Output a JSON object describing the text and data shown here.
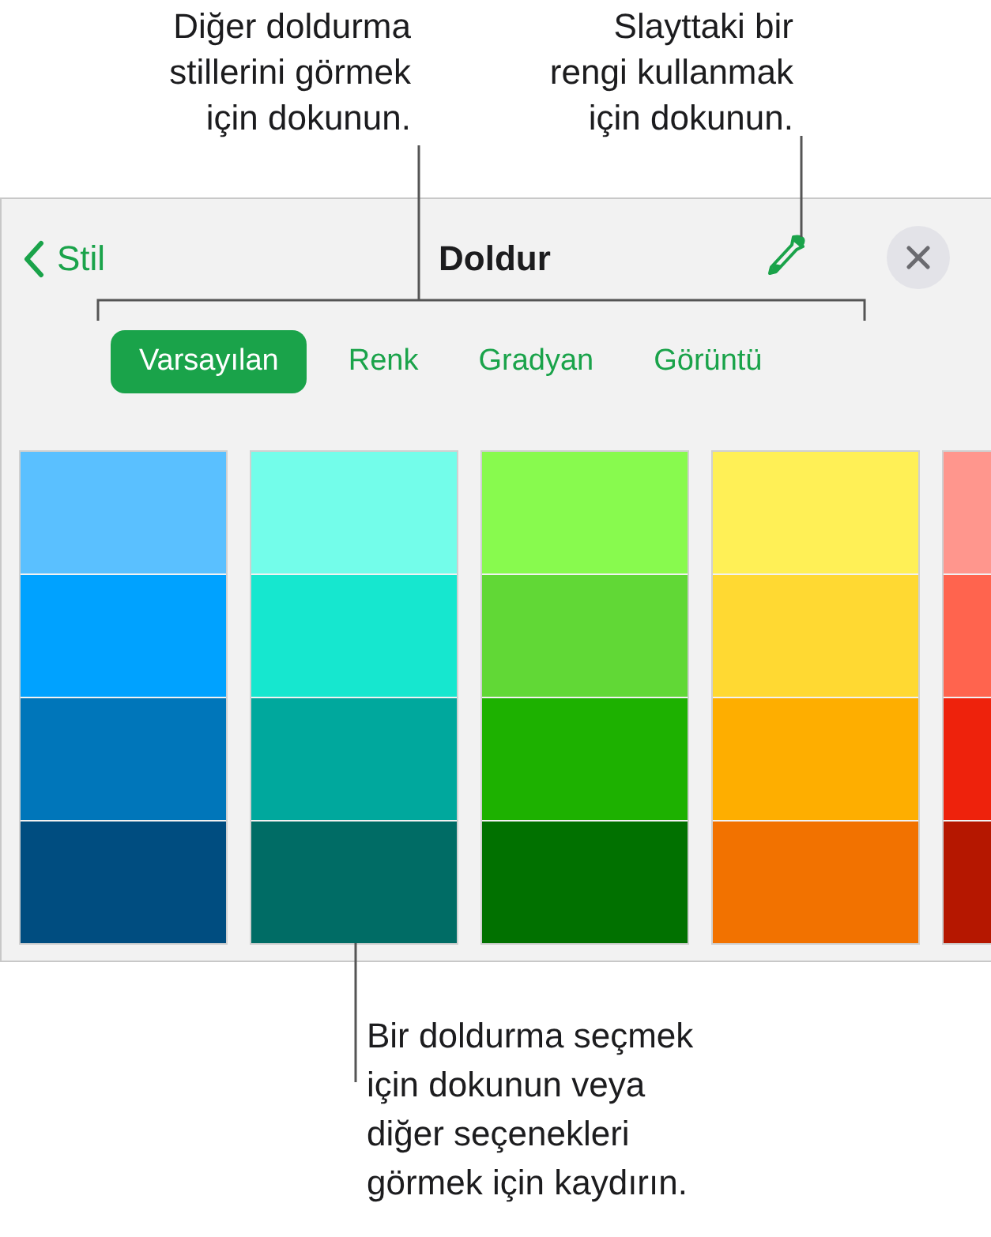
{
  "callouts": [
    {
      "text": "Diğer doldurma\nstillerini görmek\niçin dokunun."
    },
    {
      "text": "Slayttaki bir\nrengi kullanmak\niçin dokunun."
    },
    {
      "text": "Bir doldurma seçmek\niçin dokunun veya\ndiğer seçenekleri\ngörmek için kaydırın."
    }
  ],
  "panel": {
    "back_button": "Stil",
    "title": "Doldur",
    "tabs": [
      {
        "label": "Varsayılan",
        "selected": true
      },
      {
        "label": "Renk",
        "selected": false
      },
      {
        "label": "Gradyan",
        "selected": false
      },
      {
        "label": "Görüntü",
        "selected": false
      }
    ],
    "swatch_columns": [
      {
        "swatches": [
          {
            "color": "#5ac0ff"
          },
          {
            "color": "#00a2ff"
          },
          {
            "color": "#0076ba"
          },
          {
            "color": "#004d80"
          }
        ]
      },
      {
        "swatches": [
          {
            "color": "#73fdea"
          },
          {
            "color": "#16e7cf"
          },
          {
            "color": "#00a89d"
          },
          {
            "color": "#006c65"
          }
        ]
      },
      {
        "swatches": [
          {
            "color": "#88fa4e"
          },
          {
            "color": "#61d836"
          },
          {
            "color": "#1db100"
          },
          {
            "color": "#017100"
          }
        ]
      },
      {
        "swatches": [
          {
            "color": "#fff056"
          },
          {
            "color": "#ffd932"
          },
          {
            "color": "#feae00"
          },
          {
            "color": "#f27200"
          }
        ]
      },
      {
        "swatches": [
          {
            "color": "#ff968d"
          },
          {
            "color": "#ff644e"
          },
          {
            "color": "#ee220c"
          },
          {
            "color": "#b51700"
          }
        ]
      }
    ]
  }
}
